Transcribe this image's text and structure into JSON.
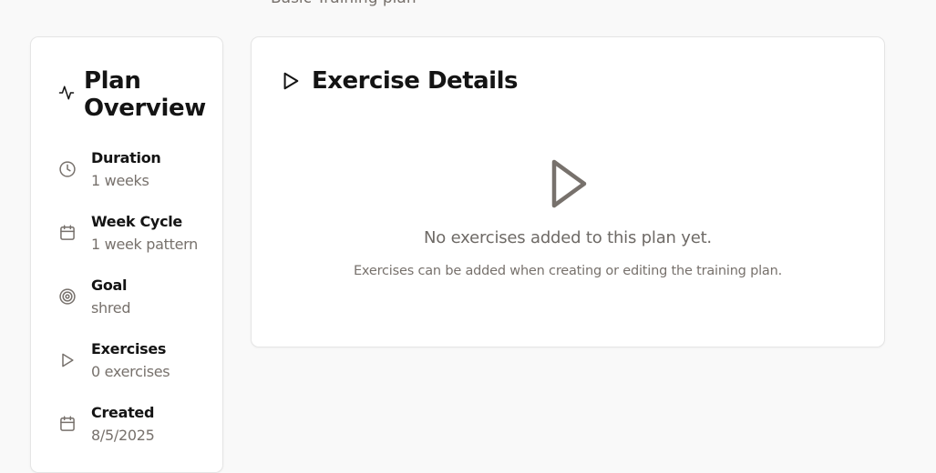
{
  "header": {
    "subtitle": "Basic Training plan"
  },
  "overview": {
    "title": "Plan Overview",
    "icon": "activity-icon",
    "items": [
      {
        "label": "Duration",
        "value": "1 weeks",
        "icon": "clock-icon"
      },
      {
        "label": "Week Cycle",
        "value": "1 week pattern",
        "icon": "calendar-icon"
      },
      {
        "label": "Goal",
        "value": "shred",
        "icon": "target-icon"
      },
      {
        "label": "Exercises",
        "value": "0 exercises",
        "icon": "play-icon"
      },
      {
        "label": "Created",
        "value": "8/5/2025",
        "icon": "calendar-icon"
      }
    ]
  },
  "details": {
    "title": "Exercise Details",
    "icon": "play-icon",
    "empty_icon": "play-icon",
    "empty_message": "No exercises added to this plan yet.",
    "empty_hint": "Exercises can be added when creating or editing the training plan."
  },
  "colors": {
    "text": "#141414",
    "muted": "#77716c",
    "background": "#f9f9f9",
    "card": "#ffffff"
  }
}
